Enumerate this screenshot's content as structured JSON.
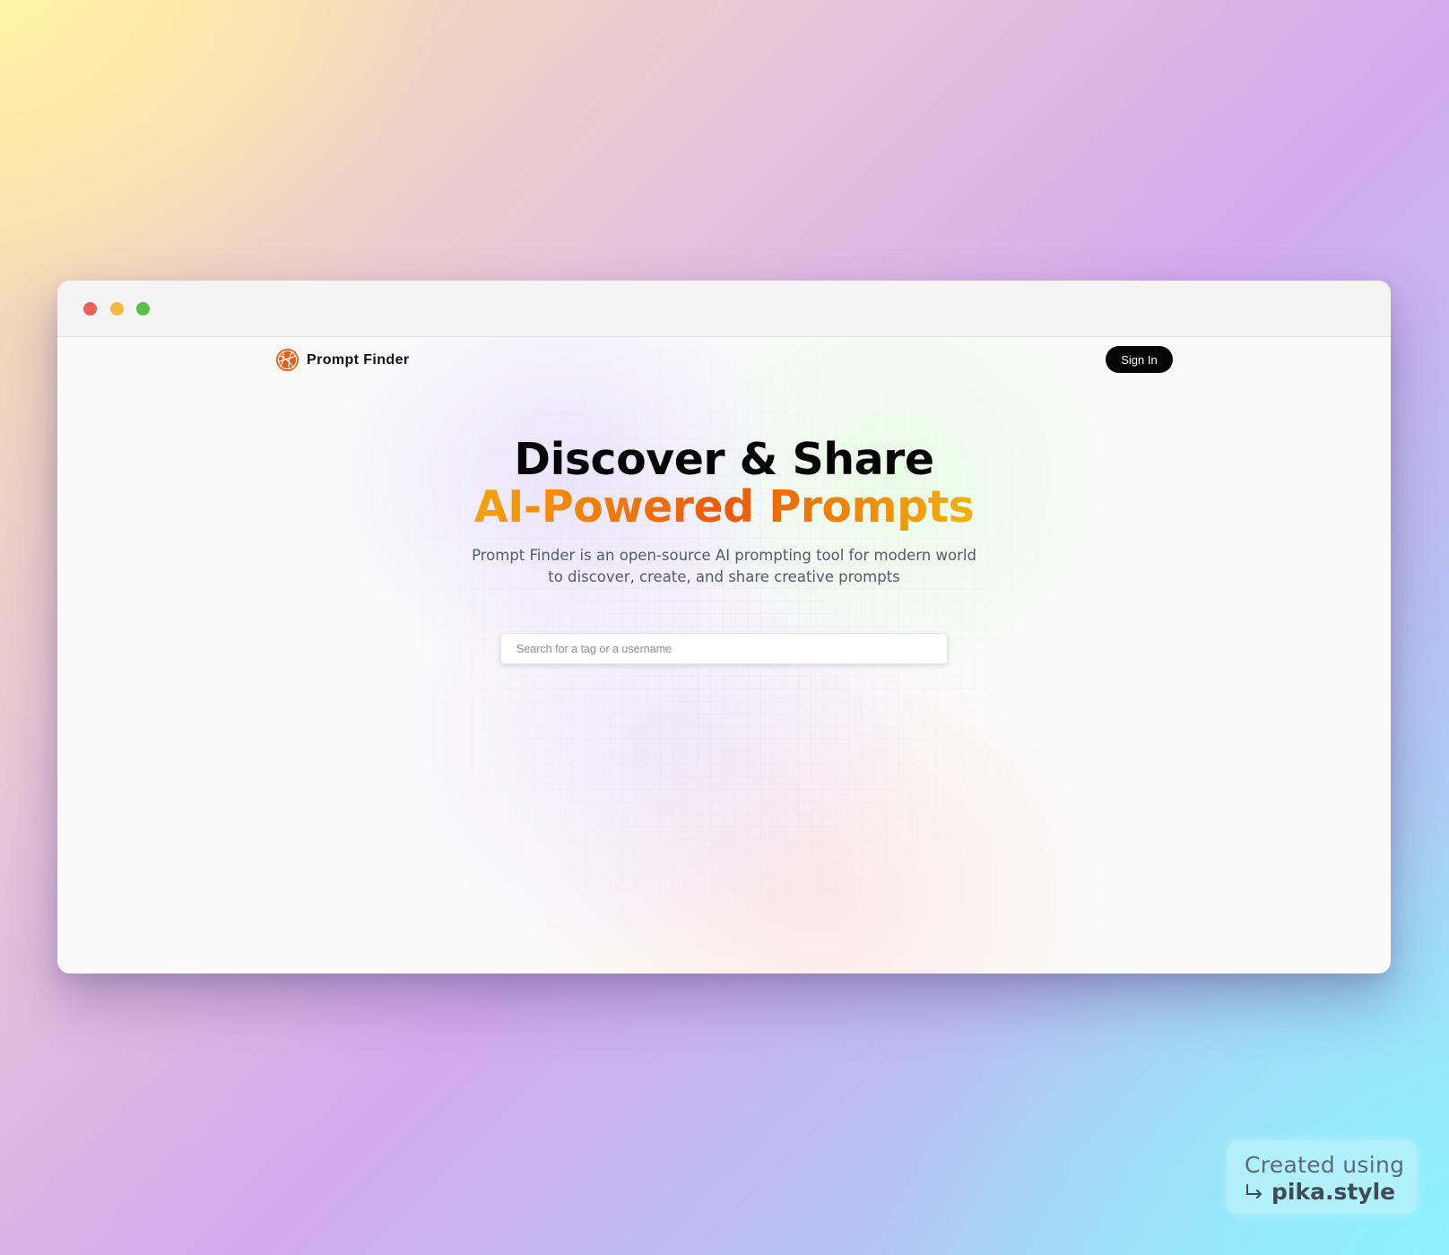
{
  "app": {
    "name": "Prompt Finder",
    "logo_icon": "globe-icon",
    "accent_color": "#ef5b12"
  },
  "window_controls": [
    "close",
    "minimize",
    "maximize"
  ],
  "nav": {
    "signin_label": "Sign In"
  },
  "hero": {
    "title_line1": "Discover & Share",
    "title_line2": "AI-Powered Prompts",
    "description": "Prompt Finder is an open-source AI prompting tool for modern world to discover, create, and share creative prompts"
  },
  "search": {
    "placeholder": "Search for a tag or a username",
    "value": ""
  },
  "watermark": {
    "line1": "Created using",
    "brand": "pika.style",
    "icon": "corner-arrow-icon"
  }
}
